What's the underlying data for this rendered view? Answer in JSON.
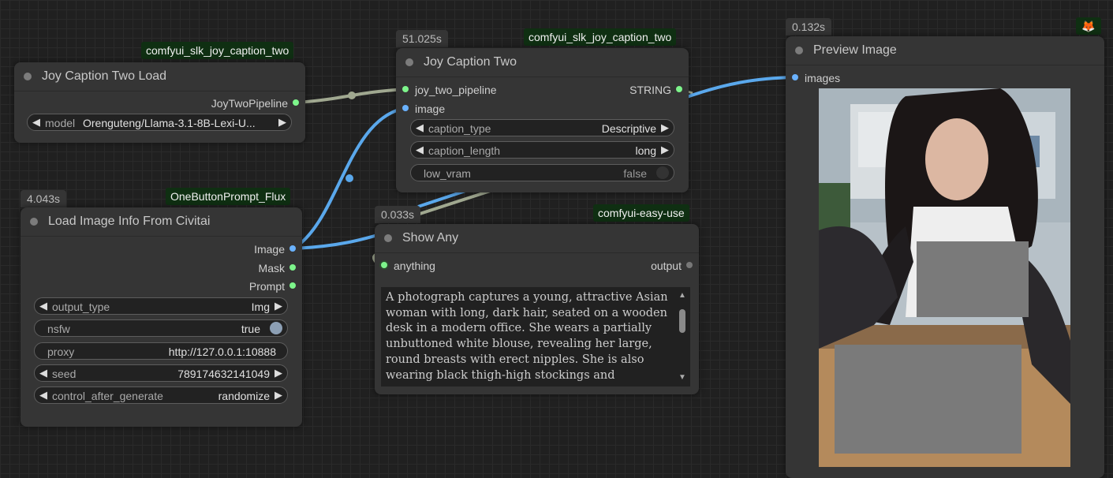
{
  "nodes": {
    "joy_load": {
      "title": "Joy Caption Two Load",
      "pack": "comfyui_slk_joy_caption_two",
      "output": "JoyTwoPipeline",
      "model_label": "model",
      "model_value": "Orenguteng/Llama-3.1-8B-Lexi-U..."
    },
    "civitai": {
      "title": "Load Image Info From Civitai",
      "pack": "OneButtonPrompt_Flux",
      "time": "4.043s",
      "outputs": [
        "Image",
        "Mask",
        "Prompt"
      ],
      "widgets": [
        {
          "label": "output_type",
          "value": "Img"
        },
        {
          "label": "nsfw",
          "value": "true"
        },
        {
          "label": "proxy",
          "value": "http://127.0.0.1:10888"
        },
        {
          "label": "seed",
          "value": "789174632141049"
        },
        {
          "label": "control_after_generate",
          "value": "randomize"
        }
      ]
    },
    "joy_two": {
      "title": "Joy Caption Two",
      "pack": "comfyui_slk_joy_caption_two",
      "time": "51.025s",
      "inputs": [
        "joy_two_pipeline",
        "image"
      ],
      "output": "STRING",
      "widgets": [
        {
          "label": "caption_type",
          "value": "Descriptive"
        },
        {
          "label": "caption_length",
          "value": "long"
        },
        {
          "label": "low_vram",
          "value": "false"
        }
      ]
    },
    "show_any": {
      "title": "Show Any",
      "pack": "comfyui-easy-use",
      "time": "0.033s",
      "input": "anything",
      "output": "output",
      "text": "A photograph captures a young, attractive Asian woman with long, dark hair, seated on a wooden desk in a modern office. She wears a partially unbuttoned white blouse, revealing her large, round breasts with erect nipples. She is also wearing black thigh-high stockings and"
    },
    "preview": {
      "title": "Preview Image",
      "time": "0.132s",
      "input": "images",
      "badge_icon": "🦊"
    }
  },
  "colors": {
    "link_blue": "#5aa8ec",
    "link_grey": "#a0a890",
    "pack_tag_bg": "#0f2f12",
    "node_bg": "#353535",
    "canvas_bg": "#202020"
  }
}
